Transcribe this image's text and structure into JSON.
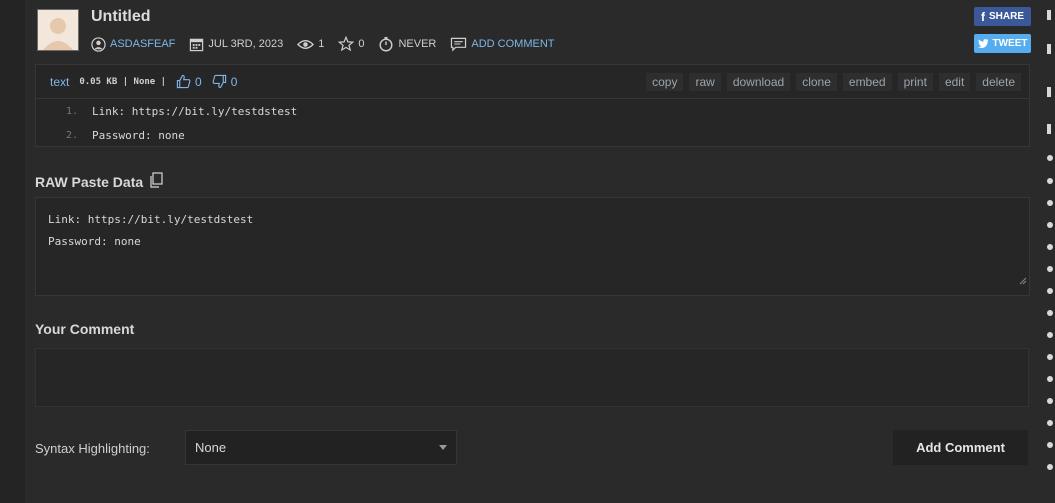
{
  "paste": {
    "title": "Untitled",
    "username": "ASDASFEAF",
    "date": "JUL 3RD, 2023",
    "views": "1",
    "stars": "0",
    "expiration": "NEVER",
    "add_comment_link": "ADD COMMENT"
  },
  "social": {
    "share_label": "SHARE",
    "tweet_label": "TWEET"
  },
  "code_panel": {
    "syntax": "text",
    "size": "0.05 KB | None |",
    "likes": "0",
    "dislikes": "0",
    "actions": [
      "copy",
      "raw",
      "download",
      "clone",
      "embed",
      "print",
      "edit",
      "delete"
    ],
    "lines": [
      {
        "num": "1.",
        "text": "Link: https://bit.ly/testdstest"
      },
      {
        "num": "2.",
        "text": "Password: none"
      }
    ]
  },
  "raw_section": {
    "heading": "RAW Paste Data",
    "lines": [
      "Link: https://bit.ly/testdstest",
      "Password: none"
    ]
  },
  "comment_section": {
    "heading": "Your Comment",
    "syntax_label": "Syntax Highlighting:",
    "syntax_value": "None",
    "submit_label": "Add Comment"
  },
  "colors": {
    "background": "#2a2a2a",
    "link": "#7fb6e8",
    "facebook": "#3b5998",
    "twitter": "#55acee"
  }
}
